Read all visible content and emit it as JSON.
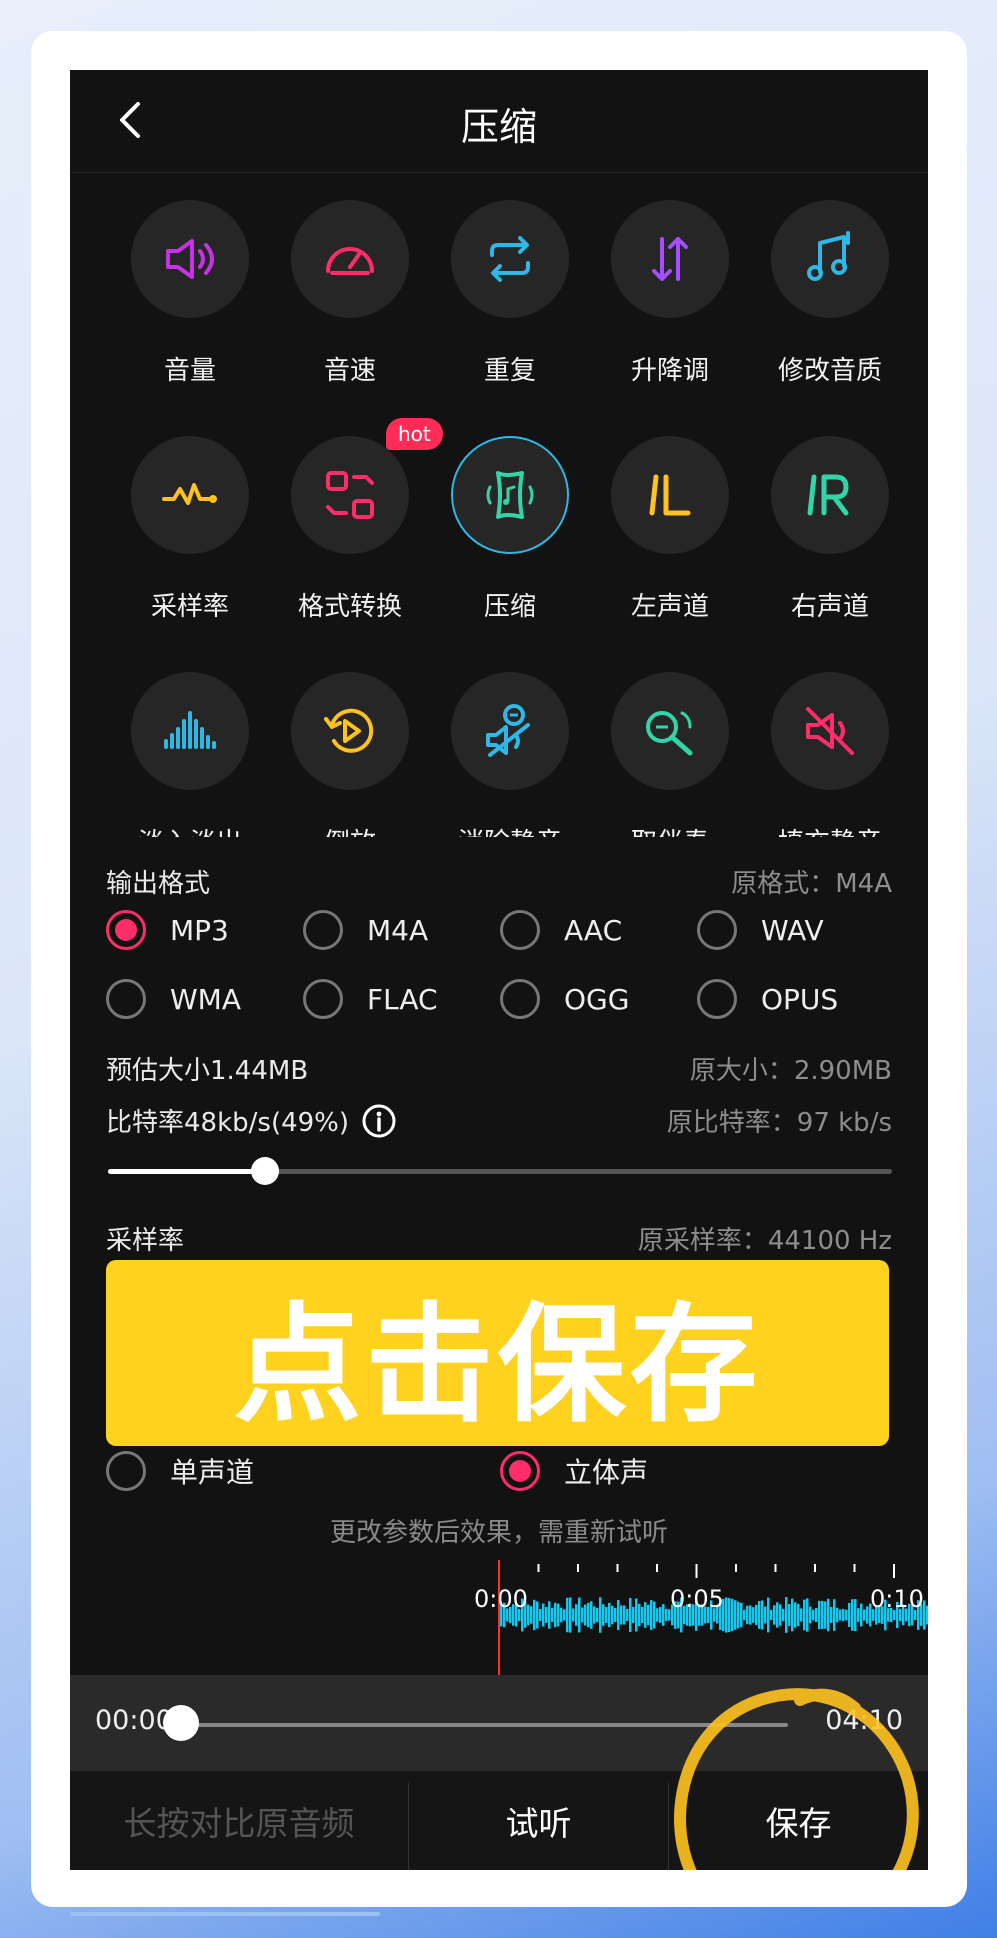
{
  "header": {
    "title": "压缩"
  },
  "tools": [
    {
      "label": "音量",
      "icon": "volume-icon",
      "color": "#c633e6"
    },
    {
      "label": "音速",
      "icon": "speedometer-icon",
      "color": "#ff2d6a"
    },
    {
      "label": "重复",
      "icon": "repeat-icon",
      "color": "#2fb7e6"
    },
    {
      "label": "升降调",
      "icon": "pitch-icon",
      "color": "#a64dff"
    },
    {
      "label": "修改音质",
      "icon": "music-note-icon",
      "color": "#2fb7e6"
    },
    {
      "label": "采样率",
      "icon": "sample-wave-icon",
      "color": "#ffc21f"
    },
    {
      "label": "格式转换",
      "icon": "format-convert-icon",
      "color": "#ff2d6a",
      "badge": "hot"
    },
    {
      "label": "压缩",
      "icon": "compress-icon",
      "color": "#31d6a8"
    },
    {
      "label": "左声道",
      "icon": "left-channel-icon",
      "color": "#ffc21f"
    },
    {
      "label": "右声道",
      "icon": "right-channel-icon",
      "color": "#31d6a8"
    },
    {
      "label": "淡入淡出",
      "icon": "fade-icon",
      "color": "#2fb7e6"
    },
    {
      "label": "倒放",
      "icon": "reverse-play-icon",
      "color": "#ffc21f"
    },
    {
      "label": "消除静音",
      "icon": "remove-silence-icon",
      "color": "#2fb7e6"
    },
    {
      "label": "取伴奏",
      "icon": "microphone-icon",
      "color": "#31d6a8"
    },
    {
      "label": "填充静音",
      "icon": "mute-icon",
      "color": "#ff2d6a"
    }
  ],
  "output": {
    "label": "输出格式",
    "original_format": "原格式：M4A",
    "formats": [
      "MP3",
      "M4A",
      "AAC",
      "WAV",
      "WMA",
      "FLAC",
      "OGG",
      "OPUS"
    ],
    "selected": "MP3"
  },
  "size": {
    "estimate": "预估大小1.44MB",
    "original": "原大小：2.90MB",
    "bitrate": "比特率48kb/s(49%)",
    "original_bitrate": "原比特率：97 kb/s",
    "bitrate_fraction": 0.2
  },
  "sample": {
    "label": "采样率",
    "original": "原采样率：44100 Hz"
  },
  "banner": {
    "text": "点击保存"
  },
  "channels": {
    "mono": "单声道",
    "stereo": "立体声",
    "selected": "stereo"
  },
  "note": "更改参数后效果，需重新试听",
  "waveform": {
    "labels": [
      "0:00",
      "0:05",
      "0:10"
    ],
    "color": "#14c8f0"
  },
  "player": {
    "current": "00:00",
    "total": "04:10",
    "progress": 0.0
  },
  "bottom": {
    "compare": "长按对比原音频",
    "preview": "试听",
    "save": "保存"
  }
}
